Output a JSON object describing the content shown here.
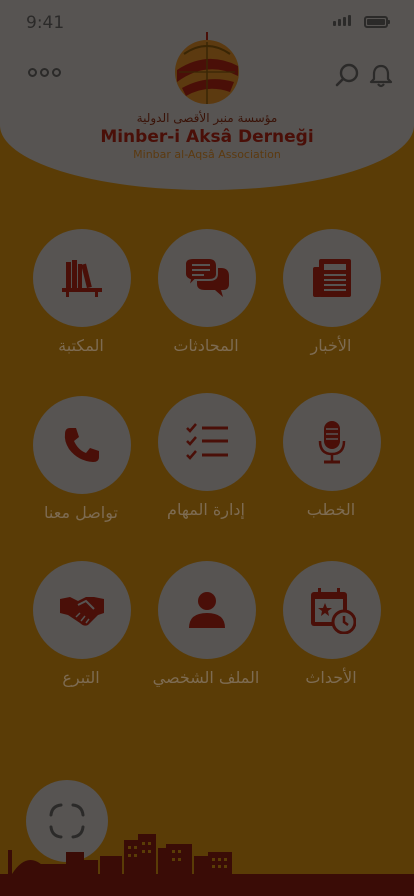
{
  "status_bar": {
    "time": "9:41"
  },
  "header": {
    "org_name_ar": "مؤسسة منبر الأقصى الدولية",
    "org_name_tr": "Minber-i Aksâ Derneği",
    "org_name_en": "Minbar al-Aqsâ Association"
  },
  "menu": {
    "news": "الأخبار",
    "chats": "المحادثات",
    "library": "المكتبة",
    "sermons": "الخطب",
    "tasks": "إدارة المهام",
    "contact": "تواصل معنا",
    "events": "الأحداث",
    "profile": "الملف الشخصي",
    "donate": "التبرع"
  },
  "colors": {
    "overlay_bg": "#5a3c06",
    "circle": "#575452",
    "icon": "#4a0f08",
    "label": "#7d6b52"
  }
}
